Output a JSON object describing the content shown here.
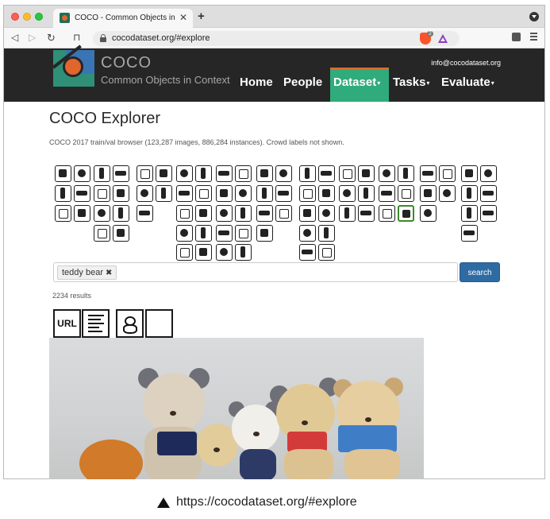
{
  "browser": {
    "tab_title": "COCO - Common Objects in Co",
    "tab_close": "✕",
    "new_tab": "+",
    "url": "cocodataset.org/#explore",
    "brave_count": "2",
    "nav": {
      "back": "◁",
      "forward": "▷",
      "reload": "↻",
      "bookmark": "⊓"
    }
  },
  "site": {
    "brand_main": "COCO",
    "brand_sub": "Common Objects in Context",
    "email": "info@cocodataset.org",
    "menu": [
      {
        "label": "Home",
        "dropdown": false
      },
      {
        "label": "People",
        "dropdown": false
      },
      {
        "label": "Dataset",
        "dropdown": true,
        "active": true
      },
      {
        "label": "Tasks",
        "dropdown": true
      },
      {
        "label": "Evaluate",
        "dropdown": true
      }
    ],
    "caret": "▾"
  },
  "explorer": {
    "title": "COCO Explorer",
    "subtitle": "COCO 2017 train/val browser (123,287 images, 886,284 instances). Crowd labels not shown.",
    "search_chip": "teddy bear",
    "chip_remove": "✖",
    "search_button": "search",
    "results": "2234 results",
    "tool_url": "URL"
  },
  "caption": "https://cocodataset.org/#explore",
  "colors": {
    "header_bg": "#262626",
    "dataset_active": "#2fab7c",
    "dataset_bar": "#e06b2c",
    "search_btn": "#2f6ba3",
    "selected_icon": "#3b8a2a"
  },
  "icons": {
    "categories": [
      "person-icon",
      "bicycle-icon",
      "car-icon",
      "traffic-light-icon",
      "fire-hydrant-icon",
      "bird-icon",
      "cat-icon",
      "frisbee-icon",
      "skis-icon",
      "bottle-icon",
      "wine-glass-icon",
      "banana-icon",
      "apple-icon",
      "chair-icon",
      "couch-icon",
      "tv-icon",
      "laptop-icon",
      "microwave-icon",
      "oven-icon",
      "book-icon",
      "clock-icon",
      "umbrella-icon",
      "handbag-icon",
      "motorcycle-icon",
      "airplane-icon",
      "stop-sign-icon",
      "parking-meter-icon",
      "dog-icon",
      "horse-icon",
      "snowboard-icon",
      "sports-ball-icon",
      "cup-icon",
      "fork-icon",
      "sandwich-icon",
      "orange-icon",
      "potted-plant-icon",
      "bed-icon",
      "mouse-icon",
      "remote-icon",
      "toaster-icon",
      "sink-icon",
      "vase-icon",
      "scissors-icon",
      "tie-icon",
      "suitcase-icon",
      "bus-icon",
      "train-icon",
      "bench-icon",
      "sheep-icon",
      "cow-icon",
      "kite-icon",
      "baseball-bat-icon",
      "knife-icon",
      "broccoli-icon",
      "carrot-icon",
      "dining-table-icon",
      "toilet-icon",
      "keyboard-icon",
      "cell-phone-icon",
      "refrigerator-icon",
      "teddy-bear-icon",
      "hair-drier-icon",
      "truck-icon",
      "boat-icon",
      "elephant-icon",
      "bear-icon",
      "baseball-glove-icon",
      "skateboard-icon",
      "spoon-icon",
      "hot-dog-icon",
      "pizza-icon",
      "toothbrush-icon",
      "zebra-icon",
      "giraffe-icon",
      "surfboard-icon",
      "tennis-racket-icon",
      "donut-icon",
      "cake-icon"
    ]
  }
}
